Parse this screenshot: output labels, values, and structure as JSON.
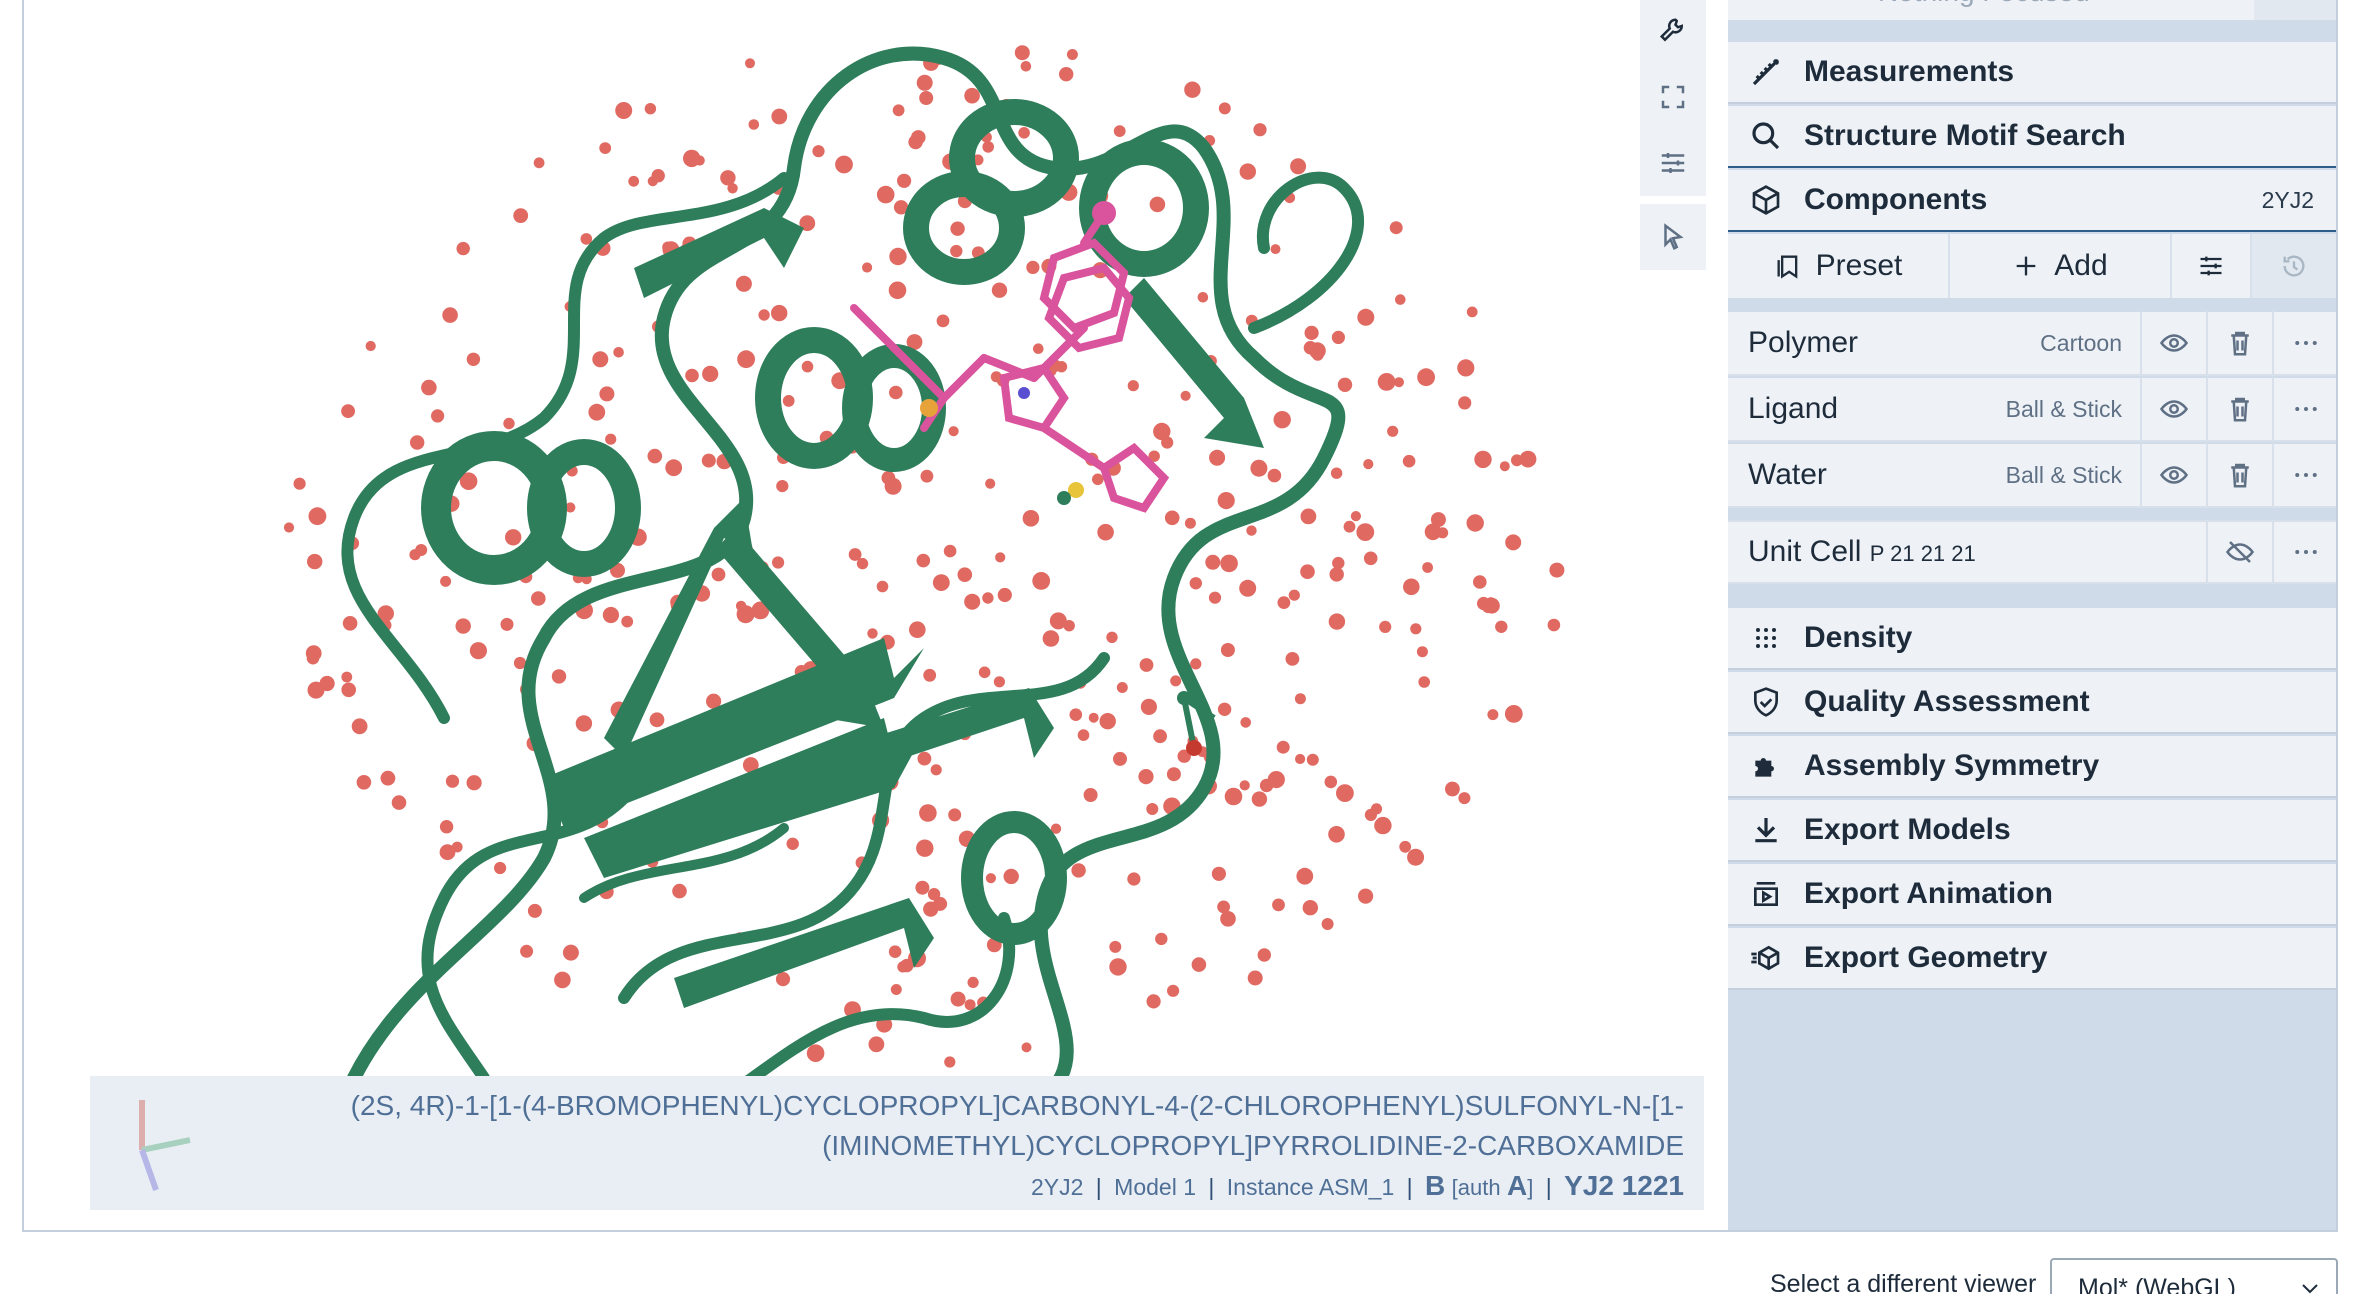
{
  "viewport": {
    "highlight": {
      "ligand_name_line1": "(2S, 4R)-1-[1-(4-BROMOPHENYL)CYCLOPROPYL]CARBONYL-4-(2-CHLOROPHENYL)SULFONYL-N-[1-",
      "ligand_name_line2": "(IMINOMETHYL)CYCLOPROPYL]PYRROLIDINE-2-CARBOXAMIDE",
      "entry": "2YJ2",
      "model": "Model 1",
      "instance": "Instance ASM_1",
      "chain": "B",
      "auth_prefix": "[auth",
      "auth_chain": "A",
      "auth_suffix": "]",
      "residue": "YJ2 1221",
      "sep": "|"
    },
    "controls": [
      "wrench-icon",
      "expand-icon",
      "sliders-icon",
      "pointer-icon"
    ],
    "colors": {
      "cartoon": "#2e7d5b",
      "water": "#e06a62",
      "ligand": "#d9549c"
    }
  },
  "panel": {
    "focus_text": "Nothing Focused",
    "measurements": "Measurements",
    "motif_search": "Structure Motif Search",
    "components": {
      "label": "Components",
      "tag": "2YJ2"
    },
    "toolbar": {
      "preset": "Preset",
      "add": "Add"
    },
    "rows": [
      {
        "name": "Polymer",
        "rep": "Cartoon"
      },
      {
        "name": "Ligand",
        "rep": "Ball & Stick"
      },
      {
        "name": "Water",
        "rep": "Ball & Stick"
      }
    ],
    "unit_cell": {
      "name": "Unit Cell",
      "group": "P 21 21 21"
    },
    "sections": [
      "Density",
      "Quality Assessment",
      "Assembly Symmetry",
      "Export Models",
      "Export Animation",
      "Export Geometry"
    ]
  },
  "footer": {
    "viewer_label": "Select a different viewer",
    "viewer_value": "Mol* (WebGL)"
  }
}
